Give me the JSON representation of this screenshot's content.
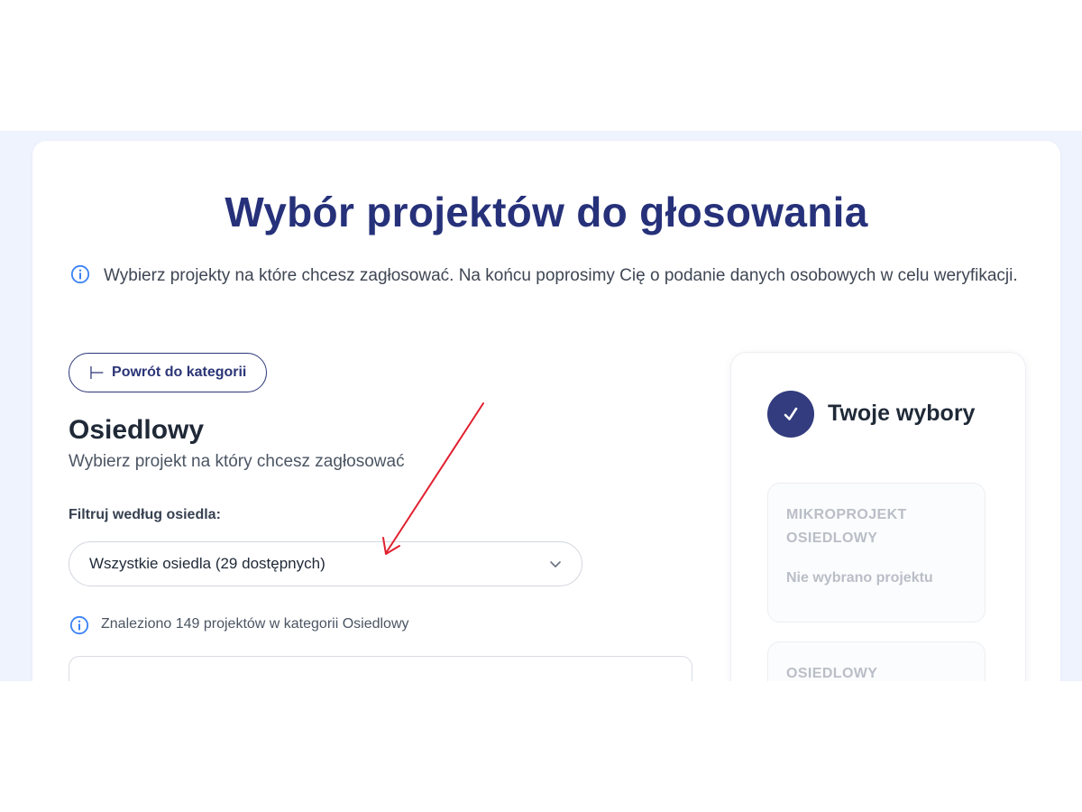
{
  "page": {
    "title": "Wybór projektów do głosowania",
    "intro": "Wybierz projekty na które chcesz zagłosować. Na końcu poprosimy Cię o podanie danych osobowych w celu weryfikacji."
  },
  "back_button": {
    "label": "Powrót do kategorii",
    "icon": "arrow-left-icon"
  },
  "category": {
    "title": "Osiedlowy",
    "subtitle": "Wybierz projekt na który chcesz zagłosować"
  },
  "filter": {
    "label": "Filtruj według osiedla:",
    "selected": "Wszystkie osiedla (29 dostępnych)"
  },
  "results_info": "Znaleziono 149 projektów w kategorii Osiedlowy",
  "choices_panel": {
    "title": "Twoje wybory",
    "slots": [
      {
        "title": "MIKROPROJEKT OSIEDLOWY",
        "status": "Nie wybrano projektu"
      },
      {
        "title": "OSIEDLOWY",
        "status": ""
      }
    ]
  },
  "colors": {
    "primary": "#26317a",
    "accent_info": "#3b82f6",
    "annotation_arrow": "#e0202f",
    "background": "#eef3fd"
  }
}
